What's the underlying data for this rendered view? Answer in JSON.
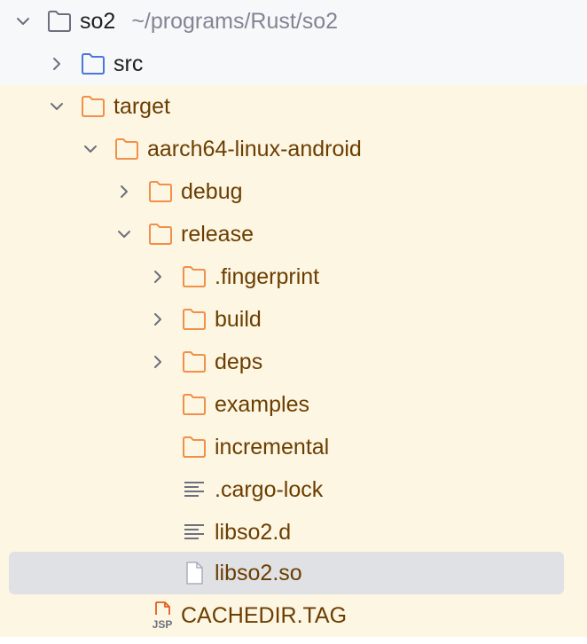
{
  "project": {
    "name": "so2",
    "path": "~/programs/Rust/so2"
  },
  "colors": {
    "root_background": "#f7f8fa",
    "excluded_background": "#fdf6e3",
    "selected_background": "#dfe1e5",
    "excluded_text": "#6b3e00",
    "excluded_folder_icon": "#f0904a",
    "source_folder_icon": "#4a78d8"
  },
  "tree": {
    "items": [
      {
        "label": "so2",
        "kind": "folder",
        "expanded": true
      },
      {
        "label": "src",
        "kind": "source-folder",
        "expanded": false
      },
      {
        "label": "target",
        "kind": "excluded-folder",
        "expanded": true
      },
      {
        "label": "aarch64-linux-android",
        "kind": "excluded-folder",
        "expanded": true
      },
      {
        "label": "debug",
        "kind": "excluded-folder",
        "expanded": false
      },
      {
        "label": "release",
        "kind": "excluded-folder",
        "expanded": true
      },
      {
        "label": ".fingerprint",
        "kind": "excluded-folder",
        "expanded": false
      },
      {
        "label": "build",
        "kind": "excluded-folder",
        "expanded": false
      },
      {
        "label": "deps",
        "kind": "excluded-folder",
        "expanded": false
      },
      {
        "label": "examples",
        "kind": "excluded-folder"
      },
      {
        "label": "incremental",
        "kind": "excluded-folder"
      },
      {
        "label": ".cargo-lock",
        "kind": "text-file"
      },
      {
        "label": "libso2.d",
        "kind": "text-file"
      },
      {
        "label": "libso2.so",
        "kind": "file",
        "selected": true
      },
      {
        "label": "CACHEDIR.TAG",
        "kind": "jsp-file",
        "icon_text": "JSP"
      }
    ]
  }
}
